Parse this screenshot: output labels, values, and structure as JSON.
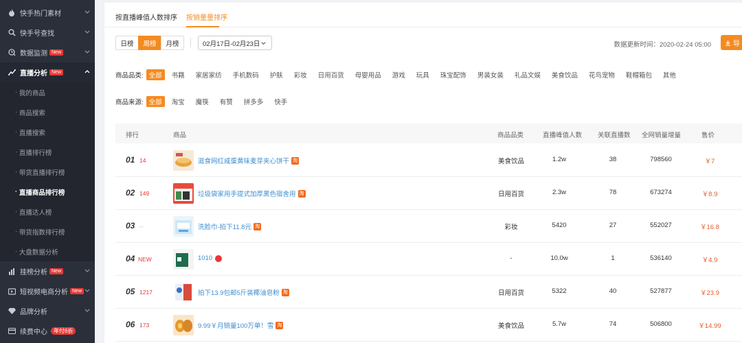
{
  "sidebar": {
    "items": [
      {
        "label": "快手热门素材",
        "icon": "flame-icon"
      },
      {
        "label": "快手号查找",
        "icon": "search-icon"
      },
      {
        "label": "数据监测",
        "icon": "monitor-icon",
        "badge": "New"
      },
      {
        "label": "直播分析",
        "icon": "trend-icon",
        "badge": "New"
      }
    ],
    "sub_items": [
      "我的商品",
      "商品搜索",
      "直播搜索",
      "直播排行榜",
      "带货直播排行榜",
      "直播商品排行榜",
      "直播达人榜",
      "带货指数排行榜",
      "大盘数据分析"
    ],
    "bottom_items": [
      {
        "label": "挂榜分析",
        "icon": "bar-chart-icon",
        "badge": "New"
      },
      {
        "label": "短视频电商分析",
        "icon": "video-icon",
        "badge": "New"
      },
      {
        "label": "品牌分析",
        "icon": "diamond-icon"
      },
      {
        "label": "续费中心",
        "icon": "card-icon",
        "badge": "年付6折"
      }
    ]
  },
  "tabs": [
    "按直播峰值人数排序",
    "按销量量排序"
  ],
  "period": {
    "options": [
      "日榜",
      "周榜",
      "月榜"
    ],
    "selected": "周榜"
  },
  "date_range": "02月17日-02月23日",
  "update_time": "数据更新时间：2020-02-24 05:00",
  "export_label": "导",
  "category_filter": {
    "label": "商品品类:",
    "options": [
      "全部",
      "书籍",
      "家居家纺",
      "手机数码",
      "护肤",
      "彩妆",
      "日用百货",
      "母婴用品",
      "游戏",
      "玩具",
      "珠宝配饰",
      "男装女装",
      "礼品文娱",
      "美食饮品",
      "花鸟宠物",
      "鞋帽箱包",
      "其他"
    ]
  },
  "source_filter": {
    "label": "商品来源:",
    "options": [
      "全部",
      "淘宝",
      "魔筷",
      "有赞",
      "拼多多",
      "快手"
    ]
  },
  "table": {
    "headers": [
      "排行",
      "商品",
      "商品品类",
      "直播峰值人数",
      "关联直播数",
      "全网销量增量",
      "售价"
    ],
    "rows": [
      {
        "rank": "01",
        "change": "14",
        "name": "滋食网红咸蛋黄味麦芽夹心饼干",
        "category": "美食饮品",
        "peak": "1.2w",
        "lives": "38",
        "sales": "798560",
        "price": "￥7"
      },
      {
        "rank": "02",
        "change": "149",
        "name": "垃圾袋家用手提式加厚黑色宿舍用",
        "category": "日用百货",
        "peak": "2.3w",
        "lives": "78",
        "sales": "673274",
        "price": "￥8.9"
      },
      {
        "rank": "03",
        "change": "--",
        "name": "洗脸巾-拍下11.8元",
        "category": "彩妆",
        "peak": "5420",
        "lives": "27",
        "sales": "552027",
        "price": "￥16.8"
      },
      {
        "rank": "04",
        "change": "NEW",
        "name": "1010",
        "category": "-",
        "peak": "10.0w",
        "lives": "1",
        "sales": "536140",
        "price": "￥4.9"
      },
      {
        "rank": "05",
        "change": "1217",
        "name": "拍下13.9包邮5斤装椰油皂粉",
        "category": "日用百货",
        "peak": "5322",
        "lives": "40",
        "sales": "527877",
        "price": "￥23.9"
      },
      {
        "rank": "06",
        "change": "173",
        "name": "9.99￥月销量100万单！雪",
        "category": "美食饮品",
        "peak": "5.7w",
        "lives": "74",
        "sales": "506800",
        "price": "￥14.99"
      }
    ]
  },
  "tao_label": "淘"
}
